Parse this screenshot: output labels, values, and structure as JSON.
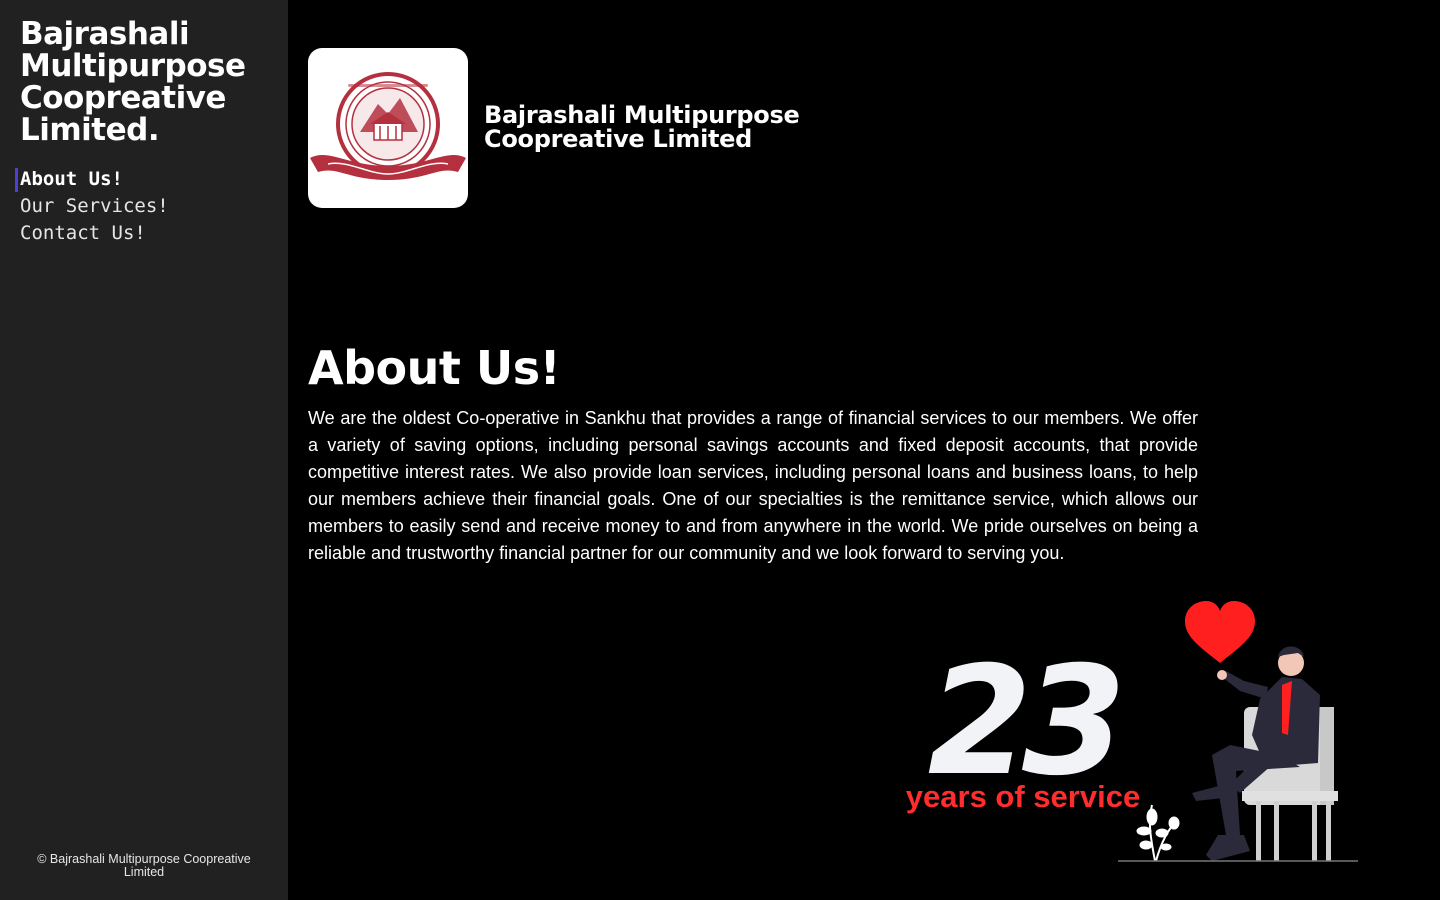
{
  "sidebar": {
    "brand": "Bajrashali Multipurpose Coopreative Limited.",
    "nav": [
      {
        "label": "About Us!",
        "active": true
      },
      {
        "label": "Our Services!",
        "active": false
      },
      {
        "label": "Contact Us!",
        "active": false
      }
    ],
    "footer": "© Bajrashali Multipurpose Coopreative Limited"
  },
  "header": {
    "org_name": "Bajrashali Multipurpose Coopreative Limited",
    "logo_icon": "cooperative-seal-logo"
  },
  "about": {
    "title": "About Us!",
    "body": "We are the oldest Co-operative in Sankhu that provides a range of financial services to our members. We offer a variety of saving options, including personal savings accounts and fixed deposit accounts, that provide competitive interest rates. We also provide loan services, including personal loans and business loans, to help our members achieve their financial goals. One of our specialties is the remittance service, which allows our members to easily send and receive money to and from anywhere in the world. We pride ourselves on being a reliable and trustworthy financial partner for our community and we look forward to serving you."
  },
  "stats": {
    "years": "23",
    "years_label": "years of service"
  },
  "colors": {
    "sidebar_bg": "#212121",
    "main_bg": "#000000",
    "accent_red": "#ff2d2d",
    "active_indicator": "#4b3fd6",
    "seal_red": "#b5303f"
  }
}
